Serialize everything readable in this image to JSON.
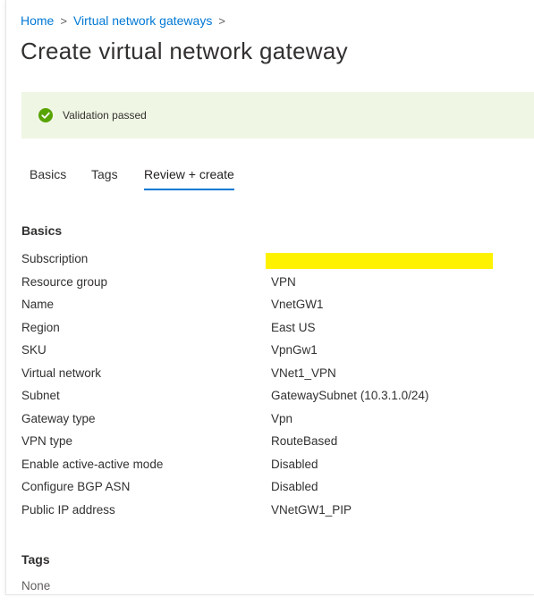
{
  "breadcrumb": {
    "home": "Home",
    "sep1": ">",
    "parent": "Virtual network gateways",
    "sep2": ">"
  },
  "page": {
    "title": "Create virtual network gateway"
  },
  "banner": {
    "message": "Validation passed",
    "icon": "check-circle-icon",
    "color": "#57a300"
  },
  "tabs": [
    {
      "label": "Basics",
      "active": false
    },
    {
      "label": "Tags",
      "active": false
    },
    {
      "label": "Review + create",
      "active": true
    }
  ],
  "basics": {
    "title": "Basics",
    "rows": [
      {
        "label": "Subscription",
        "value": ""
      },
      {
        "label": "Resource group",
        "value": "VPN"
      },
      {
        "label": "Name",
        "value": "VnetGW1"
      },
      {
        "label": "Region",
        "value": "East US"
      },
      {
        "label": "SKU",
        "value": "VpnGw1"
      },
      {
        "label": "Virtual network",
        "value": "VNet1_VPN"
      },
      {
        "label": "Subnet",
        "value": "GatewaySubnet (10.3.1.0/24)"
      },
      {
        "label": "Gateway type",
        "value": "Vpn"
      },
      {
        "label": "VPN type",
        "value": "RouteBased"
      },
      {
        "label": "Enable active-active mode",
        "value": "Disabled"
      },
      {
        "label": "Configure BGP ASN",
        "value": "Disabled"
      },
      {
        "label": "Public IP address",
        "value": "VNetGW1_PIP"
      }
    ]
  },
  "tags": {
    "title": "Tags",
    "value": "None"
  },
  "colors": {
    "accent": "#0078d4",
    "banner_bg": "#eff6e4",
    "redaction": "#fff200"
  }
}
